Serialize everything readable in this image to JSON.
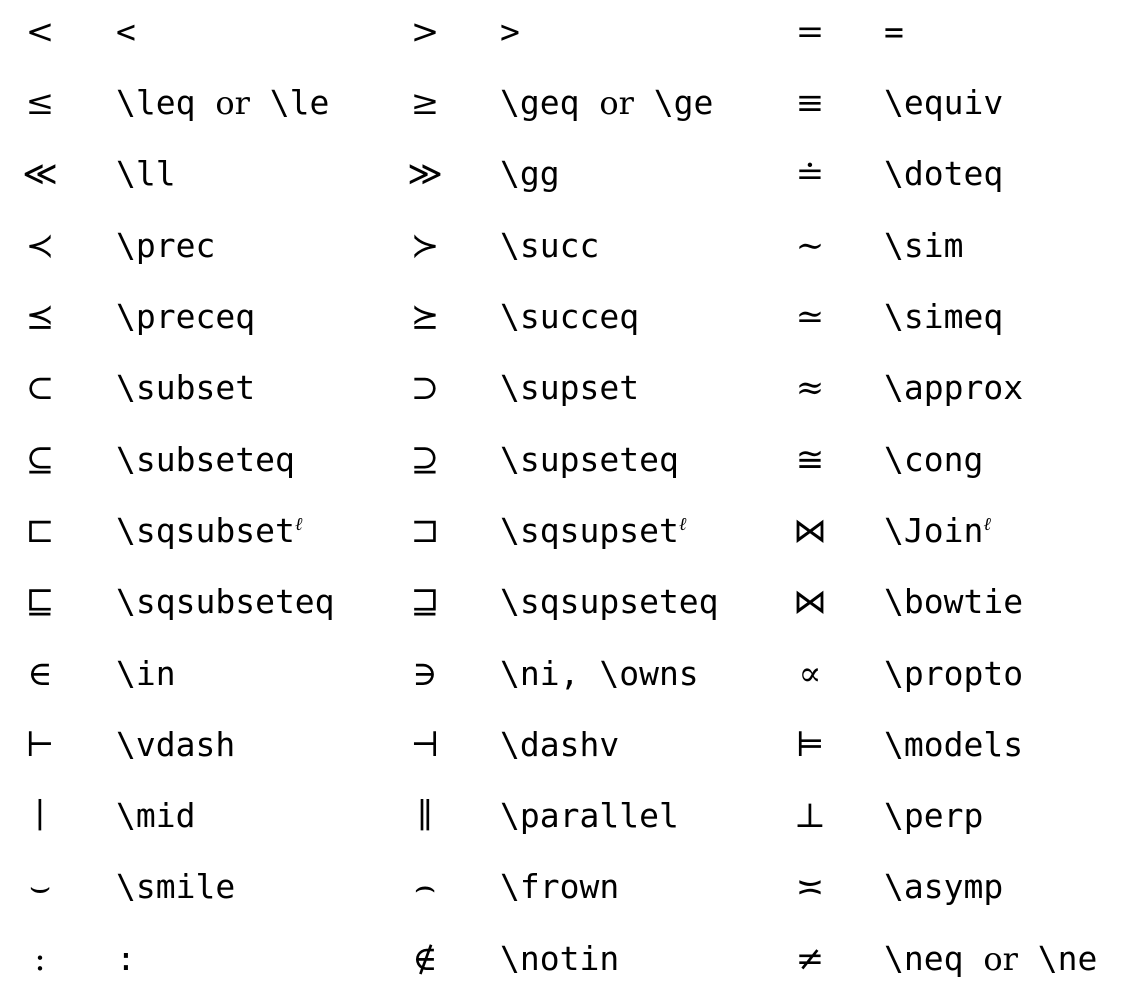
{
  "symbol_rows": [
    {
      "c1": {
        "symbol": "<",
        "command": "<"
      },
      "c2": {
        "symbol": ">",
        "command": ">"
      },
      "c3": {
        "symbol": "=",
        "command": "="
      }
    },
    {
      "c1": {
        "symbol": "≤",
        "command": "\\leq",
        "alt": "\\le"
      },
      "c2": {
        "symbol": "≥",
        "command": "\\geq",
        "alt": "\\ge"
      },
      "c3": {
        "symbol": "≡",
        "command": "\\equiv"
      }
    },
    {
      "c1": {
        "symbol": "≪",
        "command": "\\ll"
      },
      "c2": {
        "symbol": "≫",
        "command": "\\gg"
      },
      "c3": {
        "symbol": "≐",
        "command": "\\doteq"
      }
    },
    {
      "c1": {
        "symbol": "≺",
        "command": "\\prec"
      },
      "c2": {
        "symbol": "≻",
        "command": "\\succ"
      },
      "c3": {
        "symbol": "∼",
        "command": "\\sim"
      }
    },
    {
      "c1": {
        "symbol": "⪯",
        "command": "\\preceq"
      },
      "c2": {
        "symbol": "⪰",
        "command": "\\succeq"
      },
      "c3": {
        "symbol": "≃",
        "command": "\\simeq"
      }
    },
    {
      "c1": {
        "symbol": "⊂",
        "command": "\\subset"
      },
      "c2": {
        "symbol": "⊃",
        "command": "\\supset"
      },
      "c3": {
        "symbol": "≈",
        "command": "\\approx"
      }
    },
    {
      "c1": {
        "symbol": "⊆",
        "command": "\\subseteq"
      },
      "c2": {
        "symbol": "⊇",
        "command": "\\supseteq"
      },
      "c3": {
        "symbol": "≅",
        "command": "\\cong"
      }
    },
    {
      "c1": {
        "symbol": "⊏",
        "command": "\\sqsubset",
        "note": "ℓ"
      },
      "c2": {
        "symbol": "⊐",
        "command": "\\sqsupset",
        "note": "ℓ"
      },
      "c3": {
        "symbol": "⋈",
        "command": "\\Join",
        "note": "ℓ"
      }
    },
    {
      "c1": {
        "symbol": "⊑",
        "command": "\\sqsubseteq"
      },
      "c2": {
        "symbol": "⊒",
        "command": "\\sqsupseteq"
      },
      "c3": {
        "symbol": "⋈",
        "command": "\\bowtie"
      }
    },
    {
      "c1": {
        "symbol": "∈",
        "command": "\\in"
      },
      "c2": {
        "symbol": "∋",
        "command": "\\ni, \\owns"
      },
      "c3": {
        "symbol": "∝",
        "command": "\\propto"
      }
    },
    {
      "c1": {
        "symbol": "⊢",
        "command": "\\vdash"
      },
      "c2": {
        "symbol": "⊣",
        "command": "\\dashv"
      },
      "c3": {
        "symbol": "⊨",
        "command": "\\models"
      }
    },
    {
      "c1": {
        "symbol": "∣",
        "command": "\\mid"
      },
      "c2": {
        "symbol": "∥",
        "command": "\\parallel"
      },
      "c3": {
        "symbol": "⊥",
        "command": "\\perp"
      }
    },
    {
      "c1": {
        "symbol": "⌣",
        "command": "\\smile"
      },
      "c2": {
        "symbol": "⌢",
        "command": "\\frown"
      },
      "c3": {
        "symbol": "≍",
        "command": "\\asymp"
      }
    },
    {
      "c1": {
        "symbol": ":",
        "command": ":"
      },
      "c2": {
        "symbol": "∉",
        "command": "\\notin"
      },
      "c3": {
        "symbol": "≠",
        "command": "\\neq",
        "alt": "\\ne"
      }
    }
  ],
  "or_word": "or"
}
